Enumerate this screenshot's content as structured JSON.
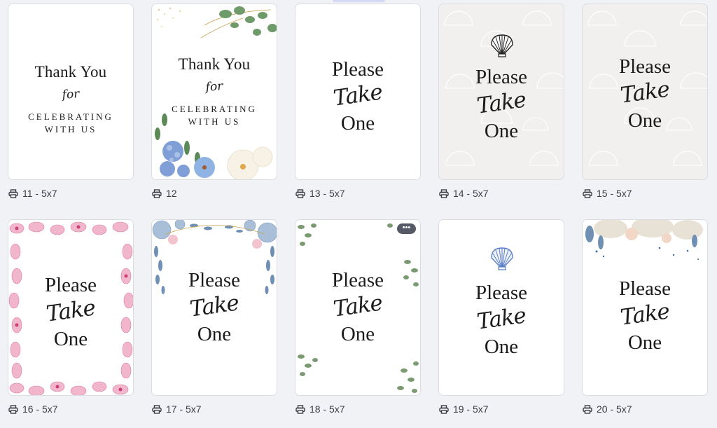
{
  "cards": [
    {
      "caption": "11 - 5x7",
      "lines": [
        "Thank You",
        "for",
        "CELEBRATING",
        "WITH US"
      ]
    },
    {
      "caption": "12",
      "lines": [
        "Thank You",
        "for",
        "CELEBRATING",
        "WITH US"
      ]
    },
    {
      "caption": "13 - 5x7",
      "lines": [
        "Please",
        "Take",
        "One"
      ]
    },
    {
      "caption": "14 - 5x7",
      "lines": [
        "Please",
        "Take",
        "One"
      ]
    },
    {
      "caption": "15 - 5x7",
      "lines": [
        "Please",
        "Take",
        "One"
      ]
    },
    {
      "caption": "16 - 5x7",
      "lines": [
        "Please",
        "Take",
        "One"
      ]
    },
    {
      "caption": "17 - 5x7",
      "lines": [
        "Please",
        "Take",
        "One"
      ]
    },
    {
      "caption": "18 - 5x7",
      "lines": [
        "Please",
        "Take",
        "One"
      ],
      "more_label": "•••"
    },
    {
      "caption": "19 - 5x7",
      "lines": [
        "Please",
        "Take",
        "One"
      ]
    },
    {
      "caption": "20 - 5x7",
      "lines": [
        "Please",
        "Take",
        "One"
      ]
    }
  ],
  "icons": {
    "print": "printer-icon",
    "shell": "seashell-icon",
    "more": "more-options-icon"
  },
  "colors": {
    "background": "#f1f2f6",
    "text": "#1c1c1c",
    "caption": "#3b3d45",
    "more_button": "#555a66"
  }
}
